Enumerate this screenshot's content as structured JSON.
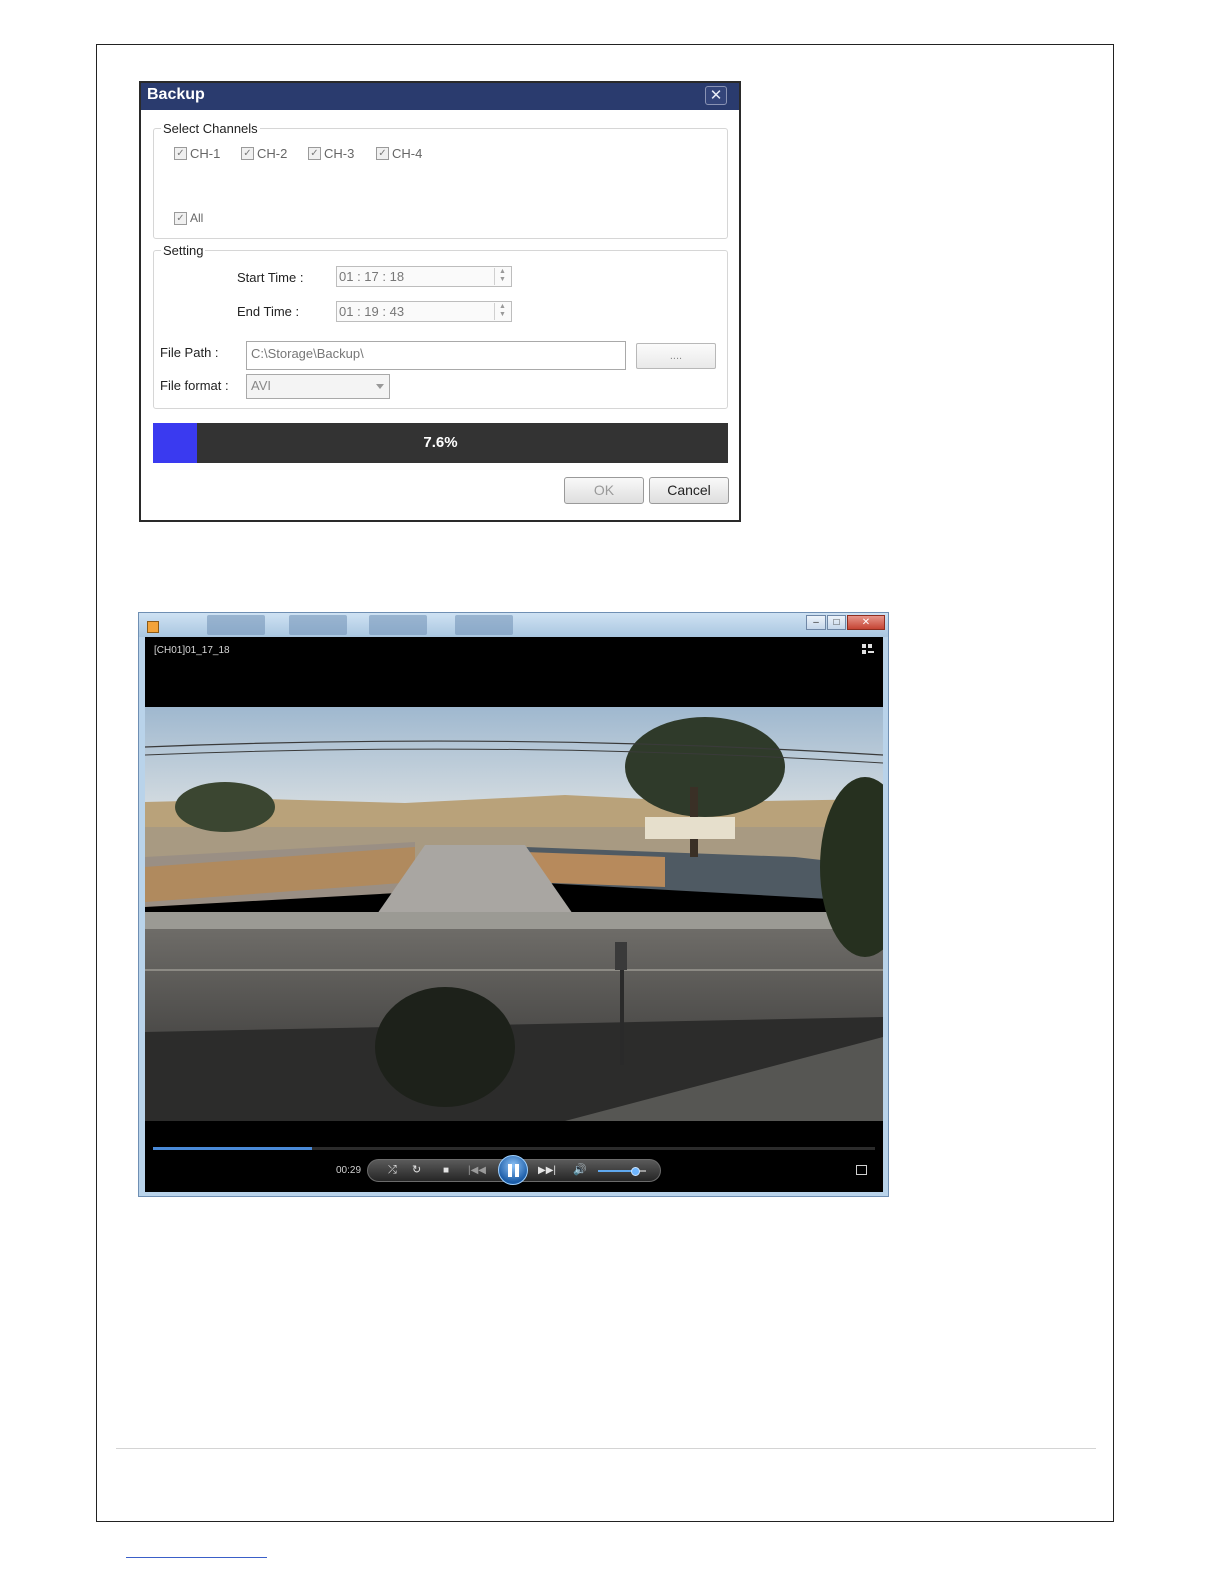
{
  "backup_dialog": {
    "title": "Backup",
    "close_icon": "close-icon",
    "select_channels": {
      "legend": "Select Channels",
      "channels": [
        "CH-1",
        "CH-2",
        "CH-3",
        "CH-4"
      ],
      "all_label": "All"
    },
    "setting": {
      "legend": "Setting",
      "start_time_label": "Start Time :",
      "start_time_value": "01 : 17 : 18",
      "end_time_label": "End Time :",
      "end_time_value": "01 : 19 : 43",
      "file_path_label": "File Path :",
      "file_path_value": "C:\\Storage\\Backup\\",
      "browse_label": "....",
      "file_format_label": "File format :",
      "file_format_value": "AVI"
    },
    "progress": {
      "percent": 7.6,
      "label": "7.6%"
    },
    "ok_label": "OK",
    "cancel_label": "Cancel"
  },
  "media_player": {
    "overlay_title": "[CH01]01_17_18",
    "time": "00:29",
    "seek_fraction": 0.22,
    "volume_fraction": 0.78,
    "colors": {
      "accent": "#4a8ad8",
      "title_bar": "#2a3b6e",
      "progress_fill": "#3a3af0"
    }
  }
}
